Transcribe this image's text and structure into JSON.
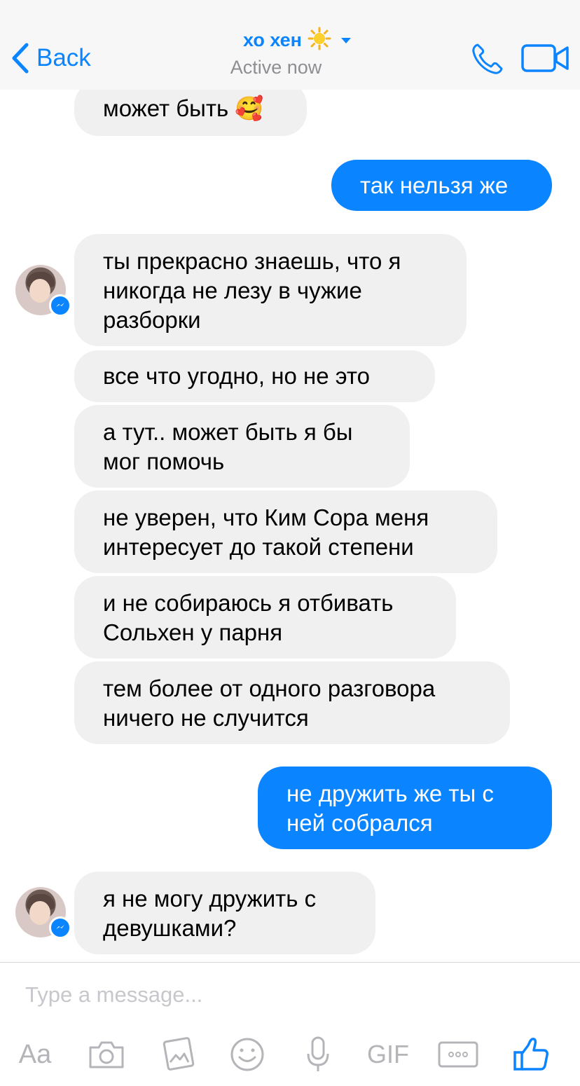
{
  "header": {
    "back_label": "Back",
    "contact_name": "хо хен",
    "name_emoji": "☀️",
    "status": "Active now",
    "icons": [
      "chevron-left-icon",
      "sun-emoji-icon",
      "caret-down-icon",
      "phone-icon",
      "video-camera-icon"
    ]
  },
  "messages": [
    {
      "direction": "incoming",
      "text": "может быть 🥰"
    },
    {
      "direction": "outgoing",
      "text": "так нельзя же"
    },
    {
      "direction": "incoming",
      "text": "ты прекрасно знаешь, что я никогда не лезу в чужие разборки"
    },
    {
      "direction": "incoming",
      "text": "все что угодно, но не это"
    },
    {
      "direction": "incoming",
      "text": "а тут.. может быть я бы мог помочь"
    },
    {
      "direction": "incoming",
      "text": "не уверен, что Ким Сора меня интересует до такой степени"
    },
    {
      "direction": "incoming",
      "text": "и не собираюсь я отбивать Сольхен у парня"
    },
    {
      "direction": "incoming",
      "text": "тем более от одного разговора ничего не случится"
    },
    {
      "direction": "outgoing",
      "text": "не дружить же ты с ней собрался"
    },
    {
      "direction": "incoming",
      "text": "я не могу дружить с девушками?"
    }
  ],
  "composer": {
    "placeholder": "Type a message..."
  },
  "toolbar": {
    "text_label": "Aa",
    "gif_label": "GIF",
    "icons": [
      "text-format-icon",
      "camera-icon",
      "photo-icon",
      "smiley-icon",
      "microphone-icon",
      "gif-icon",
      "more-icon",
      "thumbs-up-icon"
    ]
  },
  "colors": {
    "accent": "#0a84ff",
    "incoming_bubble": "#f1f0f0",
    "header_bg": "#f7f7f7",
    "muted": "#8e8e93"
  }
}
